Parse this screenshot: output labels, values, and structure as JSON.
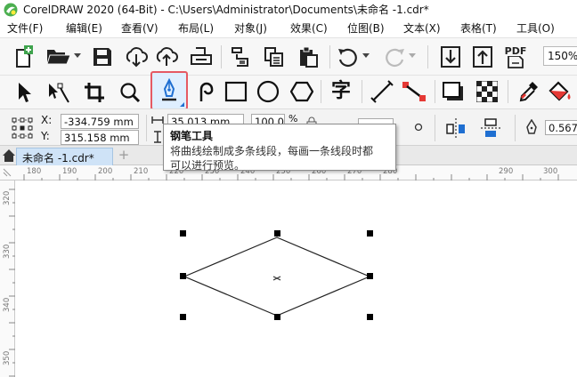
{
  "window": {
    "title": "CorelDRAW 2020 (64-Bit) - C:\\Users\\Administrator\\Documents\\未命名 -1.cdr*"
  },
  "menu": {
    "items": [
      "文件(F)",
      "编辑(E)",
      "查看(V)",
      "布局(L)",
      "对象(J)",
      "效果(C)",
      "位图(B)",
      "文本(X)",
      "表格(T)",
      "工具(O)"
    ]
  },
  "standard_toolbar": {
    "pdf_label": "PDF",
    "zoom_value": "150%"
  },
  "toolbox": {
    "text_tool_glyph": "字",
    "active_tool": "pen-tool"
  },
  "property_bar": {
    "x_label": "X:",
    "y_label": "Y:",
    "x_value": "-334.759 mm",
    "y_value": "315.158 mm",
    "width_value": "35.013 mm",
    "scale_value": "100.0",
    "percent_label": "%",
    "outline_width": "0.567"
  },
  "tooltip": {
    "title": "钢笔工具",
    "body_line1": "将曲线绘制成多条线段，每画一条线段时都",
    "body_line2": "可以进行预览。"
  },
  "tabs": {
    "doc_tab_label": "未命名 -1.cdr*"
  },
  "rulers": {
    "horizontal": [
      "180",
      "190",
      "200",
      "210",
      "220",
      "230",
      "240",
      "250",
      "260",
      "270",
      "280",
      "290",
      "300"
    ],
    "vertical": [
      "320",
      "330",
      "340",
      "350"
    ]
  },
  "colors": {
    "highlight_border": "#e55a64",
    "tab_active": "#cfe3f7"
  }
}
